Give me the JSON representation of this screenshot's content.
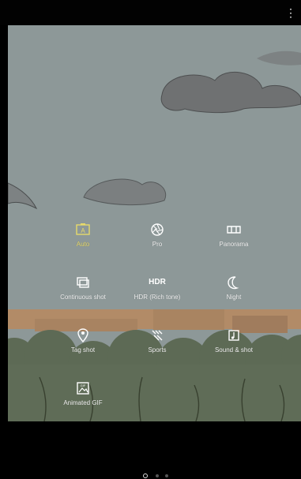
{
  "topbar": {
    "more_icon": "more-vert-icon"
  },
  "colors": {
    "accent": "#e6d96a",
    "text": "#f0f0f0",
    "bg_black": "#000000"
  },
  "modes": [
    {
      "label": "Auto",
      "icon": "auto-mode-icon",
      "active": true
    },
    {
      "label": "Pro",
      "icon": "aperture-icon",
      "active": false
    },
    {
      "label": "Panorama",
      "icon": "panorama-icon",
      "active": false
    },
    {
      "label": "Continuous shot",
      "icon": "continuous-shot-icon",
      "active": false
    },
    {
      "label": "HDR (Rich tone)",
      "icon_text": "HDR",
      "active": false
    },
    {
      "label": "Night",
      "icon": "moon-icon",
      "active": false
    },
    {
      "label": "Tag shot",
      "icon": "location-pin-icon",
      "active": false
    },
    {
      "label": "Sports",
      "icon": "sports-icon",
      "active": false
    },
    {
      "label": "Sound & shot",
      "icon": "sound-shot-icon",
      "active": false
    },
    {
      "label": "Animated GIF",
      "icon": "gif-icon",
      "active": false
    }
  ],
  "pager": {
    "pages": 3,
    "current": 1
  }
}
